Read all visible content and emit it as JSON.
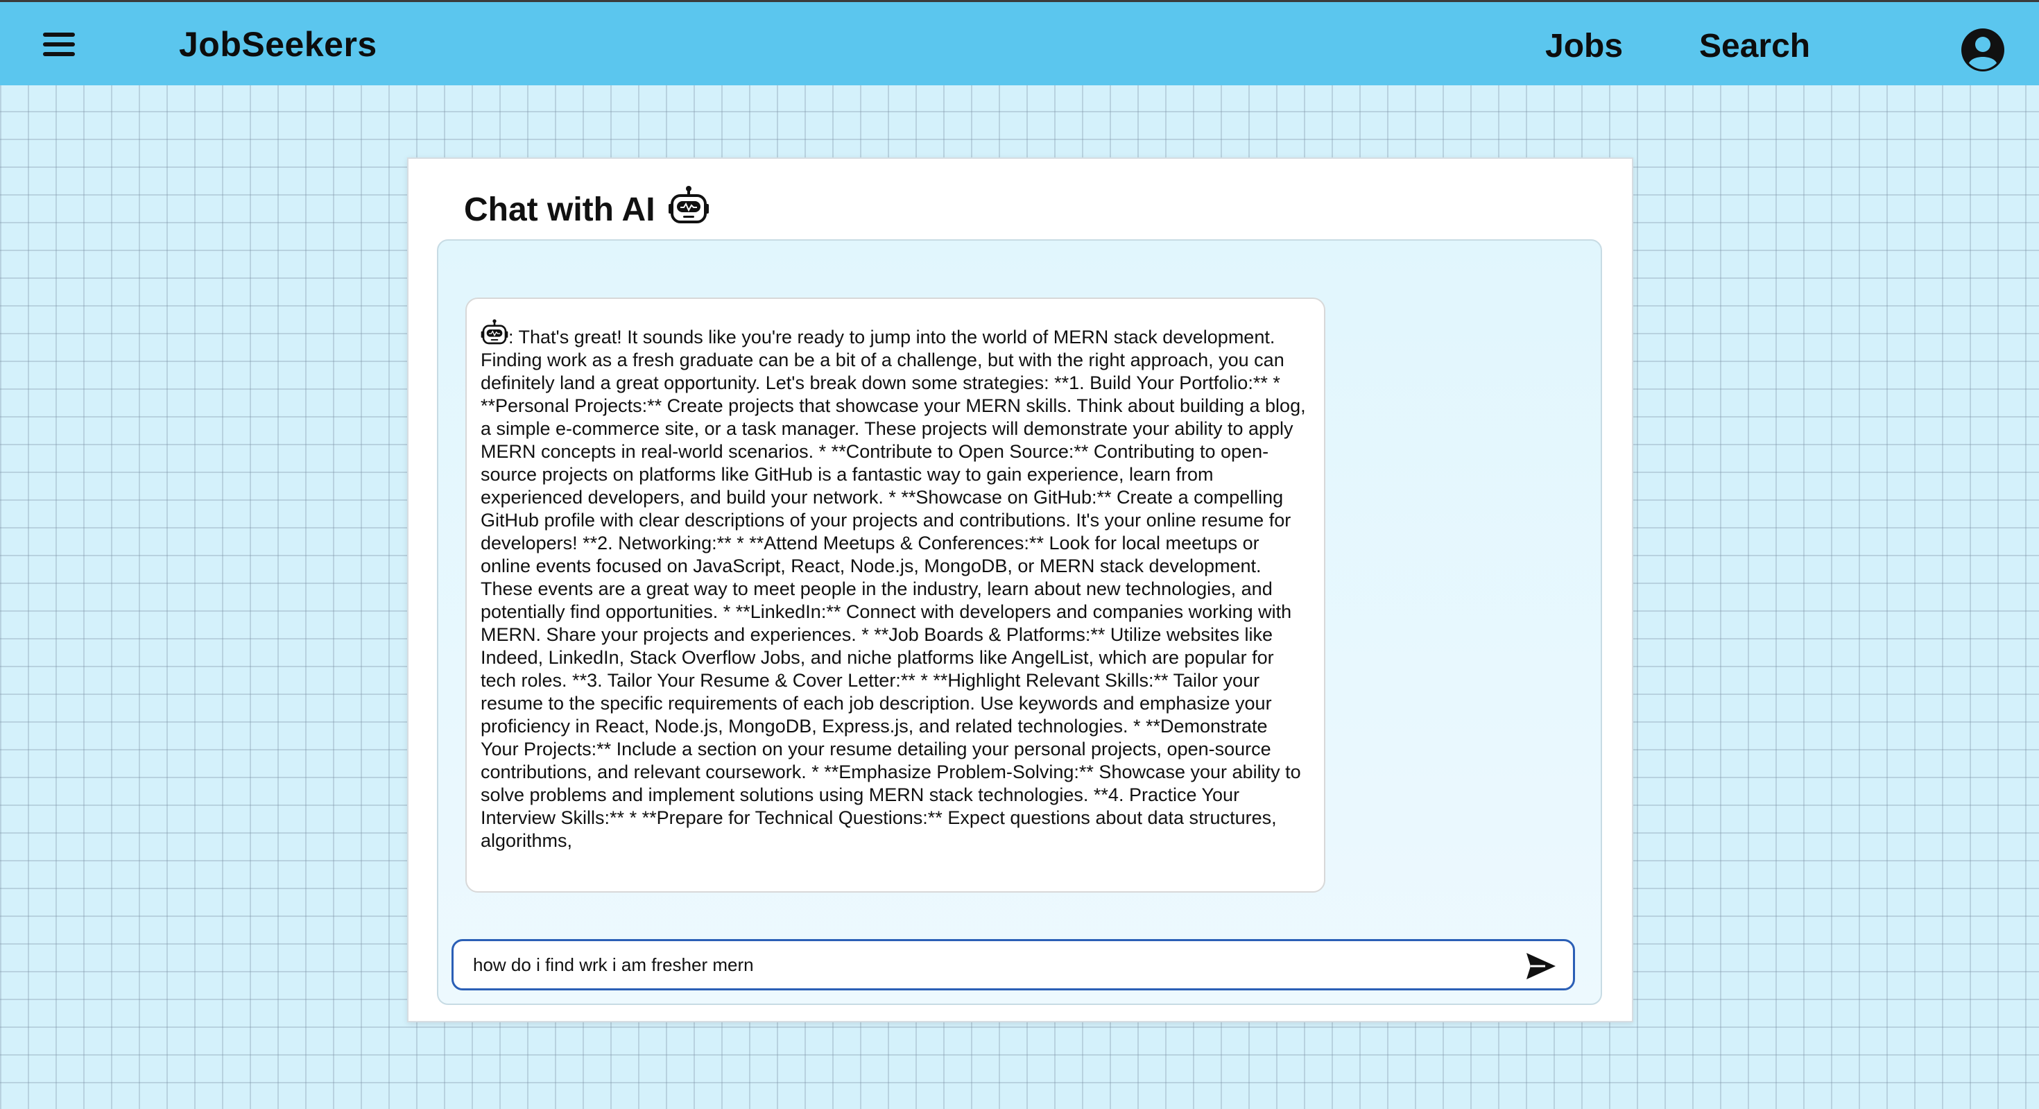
{
  "navbar": {
    "brand": "JobSeekers",
    "links": [
      "Jobs",
      "Search"
    ],
    "icons": {
      "menu": "hamburger-menu-icon",
      "account": "account-circle-icon"
    },
    "background": "#5bc6ee"
  },
  "chat": {
    "title": "Chat with AI",
    "title_icon": "robot-icon",
    "messages": [
      {
        "sender": "bot",
        "sender_icon": "robot-icon",
        "text": ": That's great! It sounds like you're ready to jump into the world of MERN stack development. Finding work as a fresh graduate can be a bit of a challenge, but with the right approach, you can definitely land a great opportunity. Let's break down some strategies: **1. Build Your Portfolio:** * **Personal Projects:** Create projects that showcase your MERN skills. Think about building a blog, a simple e-commerce site, or a task manager. These projects will demonstrate your ability to apply MERN concepts in real-world scenarios. * **Contribute to Open Source:** Contributing to open-source projects on platforms like GitHub is a fantastic way to gain experience, learn from experienced developers, and build your network. * **Showcase on GitHub:** Create a compelling GitHub profile with clear descriptions of your projects and contributions. It's your online resume for developers! **2. Networking:** * **Attend Meetups & Conferences:** Look for local meetups or online events focused on JavaScript, React, Node.js, MongoDB, or MERN stack development. These events are a great way to meet people in the industry, learn about new technologies, and potentially find opportunities. * **LinkedIn:** Connect with developers and companies working with MERN. Share your projects and experiences. * **Job Boards & Platforms:** Utilize websites like Indeed, LinkedIn, Stack Overflow Jobs, and niche platforms like AngelList, which are popular for tech roles. **3. Tailor Your Resume & Cover Letter:** * **Highlight Relevant Skills:** Tailor your resume to the specific requirements of each job description. Use keywords and emphasize your proficiency in React, Node.js, MongoDB, Express.js, and related technologies. * **Demonstrate Your Projects:** Include a section on your resume detailing your personal projects, open-source contributions, and relevant coursework. * **Emphasize Problem-Solving:** Showcase your ability to solve problems and implement solutions using MERN stack technologies. **4. Practice Your Interview Skills:** * **Prepare for Technical Questions:** Expect questions about data structures, algorithms,"
      }
    ],
    "input": {
      "value": "how do i find wrk i am fresher mern",
      "send_icon": "send-icon"
    }
  }
}
